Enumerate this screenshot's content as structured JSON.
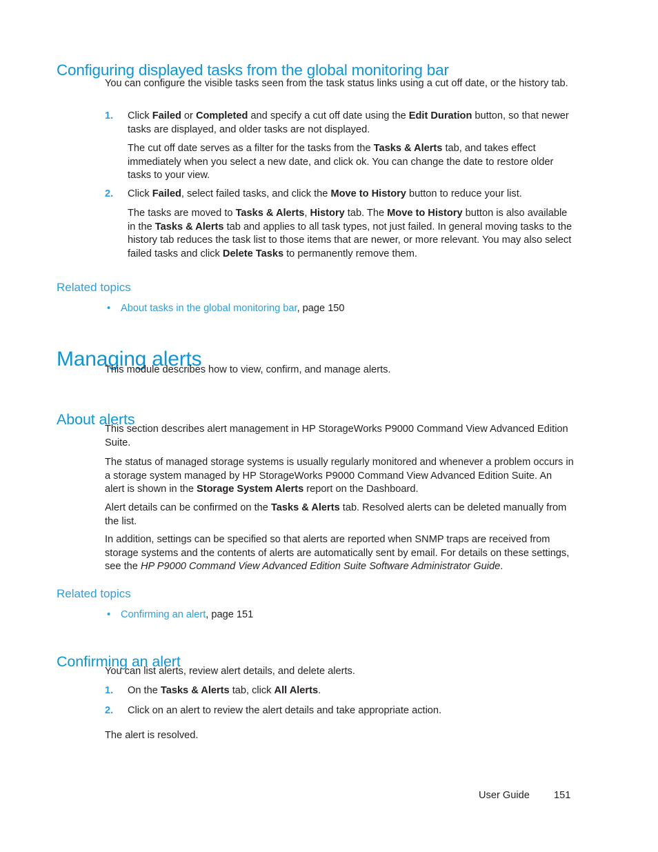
{
  "page": {
    "footer_label": "User Guide",
    "footer_page_number": "151",
    "accent_color": "#0e96d4",
    "link_color": "#2b9fdc",
    "body_color": "#231f20"
  },
  "section1": {
    "heading": "Configuring displayed tasks from the global monitoring bar",
    "intro": {
      "p1_a": "You can configure the visible tasks seen from the task status links using a cut off date, or the history tab."
    },
    "steps": [
      {
        "number": "1.",
        "text_a": "Click ",
        "bold_a": "Failed",
        "text_b": " or ",
        "bold_b": "Completed",
        "text_c": " and specify a cut off date using the ",
        "bold_c": "Edit Duration",
        "text_d": "  button, so that newer tasks are displayed, and older tasks are not displayed."
      },
      {
        "number": "2.",
        "text_a": "Click ",
        "bold_a": "Failed",
        "text_b": ", select failed tasks, and click the ",
        "bold_b": "Move to History",
        "text_c": " button to reduce your list."
      }
    ],
    "step1_note": {
      "text_a": "The cut off date serves as a filter for the tasks from the ",
      "bold_a": "Tasks & Alerts",
      "text_b": " tab, and takes effect immediately when you select a new date, and click ok. You can change the date to restore older tasks to your view."
    },
    "step2_note": {
      "text_a": "The tasks are moved to ",
      "bold_a": "Tasks & Alerts",
      "text_b": ", ",
      "bold_b": "History",
      "text_c": " tab. The ",
      "bold_c": "Move to History",
      "text_d": " button is also available in the ",
      "bold_d": "Tasks & Alerts",
      "text_e": " tab and applies to all task types, not just failed. In general moving tasks to the history tab reduces the task list to those items that are newer, or more relevant. You may also select failed tasks and click ",
      "bold_e": "Delete Tasks",
      "text_f": " to permanently remove them."
    },
    "related_topics": {
      "heading": "Related topics",
      "bullet": "•",
      "items": [
        {
          "link_text": "About tasks in the global monitoring bar",
          "suffix": ", page 150"
        }
      ]
    }
  },
  "section2": {
    "heading": "Managing alerts",
    "intro": "This module describes how to view, confirm, and manage alerts."
  },
  "section3": {
    "heading": "About alerts",
    "p1": "This section describes alert management in HP StorageWorks P9000 Command View Advanced Edition Suite.",
    "p2": {
      "text_a": "The status of managed storage systems is usually regularly monitored and whenever a problem occurs in a storage system managed by HP StorageWorks P9000 Command View Advanced Edition Suite. An alert is shown in the ",
      "bold_a": "Storage System Alerts",
      "text_b": " report on the Dashboard."
    },
    "p3": {
      "text_a": "Alert details can be confirmed on the ",
      "bold_a": "Tasks & Alerts",
      "text_b": " tab. Resolved alerts can be deleted manually from the list."
    },
    "p4": {
      "text_a": "In addition, settings can be specified so that alerts are reported when SNMP traps are received from storage systems and the contents of alerts are automatically sent by email. For details on these settings, see the ",
      "italic_a": "HP P9000 Command View Advanced Edition Suite Software Administrator Guide",
      "text_b": "."
    },
    "related_topics": {
      "heading": "Related topics",
      "bullet": "•",
      "items": [
        {
          "link_text": "Confirming an alert",
          "suffix": ", page 151"
        }
      ]
    }
  },
  "section4": {
    "heading": "Confirming an alert",
    "intro": "You can list alerts, review alert details, and delete alerts.",
    "steps": [
      {
        "number": "1.",
        "text_a": "On the ",
        "bold_a": "Tasks & Alerts",
        "text_b": " tab, click ",
        "bold_b": "All Alerts",
        "text_c": "."
      },
      {
        "number": "2.",
        "text_a": "Click on an alert to review the alert details and take appropriate action."
      }
    ],
    "outro": "The alert is resolved."
  }
}
